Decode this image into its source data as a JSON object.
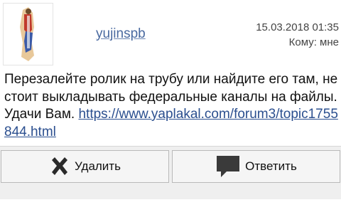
{
  "message": {
    "author": "yujinspb",
    "date": "15.03.2018 01:35",
    "recipient": "Кому: мне",
    "body_text": "Перезалейте ролик на трубу или найдите его там, не стоит выкладывать федеральные каналы на файлы. Удачи Вам. ",
    "link_text": "https://www.yaplakal.com/forum3/topic1755844.html"
  },
  "actions": {
    "delete_label": "Удалить",
    "reply_label": "Ответить"
  },
  "icons": {
    "avatar": "avatar-figure",
    "delete": "x-icon",
    "reply": "speech-bubble-icon"
  },
  "colors": {
    "link": "#2b4f8f",
    "username": "#4a6aa0",
    "button_bg": "#f5f5f5",
    "actions_bg": "#efefef"
  }
}
